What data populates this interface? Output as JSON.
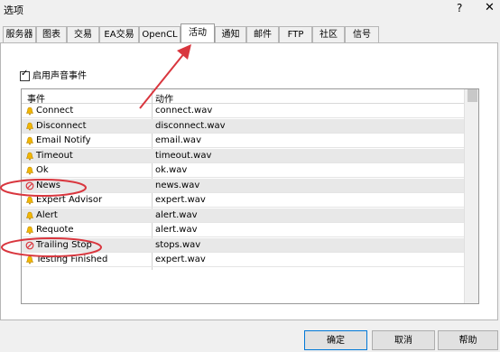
{
  "window": {
    "title": "选项",
    "help": "?",
    "close": "✕"
  },
  "tabs": [
    {
      "label": "服务器"
    },
    {
      "label": "图表"
    },
    {
      "label": "交易"
    },
    {
      "label": "EA交易"
    },
    {
      "label": "OpenCL"
    },
    {
      "label": "活动",
      "active": true
    },
    {
      "label": "通知"
    },
    {
      "label": "邮件"
    },
    {
      "label": "FTP"
    },
    {
      "label": "社区"
    },
    {
      "label": "信号"
    }
  ],
  "enable_sound": {
    "label": "启用声音事件",
    "checked": true
  },
  "table": {
    "headers": {
      "event": "事件",
      "action": "动作"
    },
    "rows": [
      {
        "event": "Connect",
        "action": "connect.wav",
        "icon": "bell-icon"
      },
      {
        "event": "Disconnect",
        "action": "disconnect.wav",
        "icon": "bell-icon"
      },
      {
        "event": "Email Notify",
        "action": "email.wav",
        "icon": "bell-icon"
      },
      {
        "event": "Timeout",
        "action": "timeout.wav",
        "icon": "bell-icon"
      },
      {
        "event": "Ok",
        "action": "ok.wav",
        "icon": "bell-icon"
      },
      {
        "event": "News",
        "action": "news.wav",
        "icon": "disabled-icon"
      },
      {
        "event": "Expert Advisor",
        "action": "expert.wav",
        "icon": "bell-icon"
      },
      {
        "event": "Alert",
        "action": "alert.wav",
        "icon": "bell-icon"
      },
      {
        "event": "Requote",
        "action": "alert.wav",
        "icon": "bell-icon"
      },
      {
        "event": "Trailing Stop",
        "action": "stops.wav",
        "icon": "disabled-icon"
      },
      {
        "event": "Testing Finished",
        "action": "expert.wav",
        "icon": "bell-icon"
      }
    ]
  },
  "buttons": {
    "ok": "确定",
    "cancel": "取消",
    "help": "帮助"
  },
  "colors": {
    "accent": "#0078d7",
    "annotation": "#d9363e",
    "bell": "#f2b600",
    "disabled": "#d9363e"
  }
}
